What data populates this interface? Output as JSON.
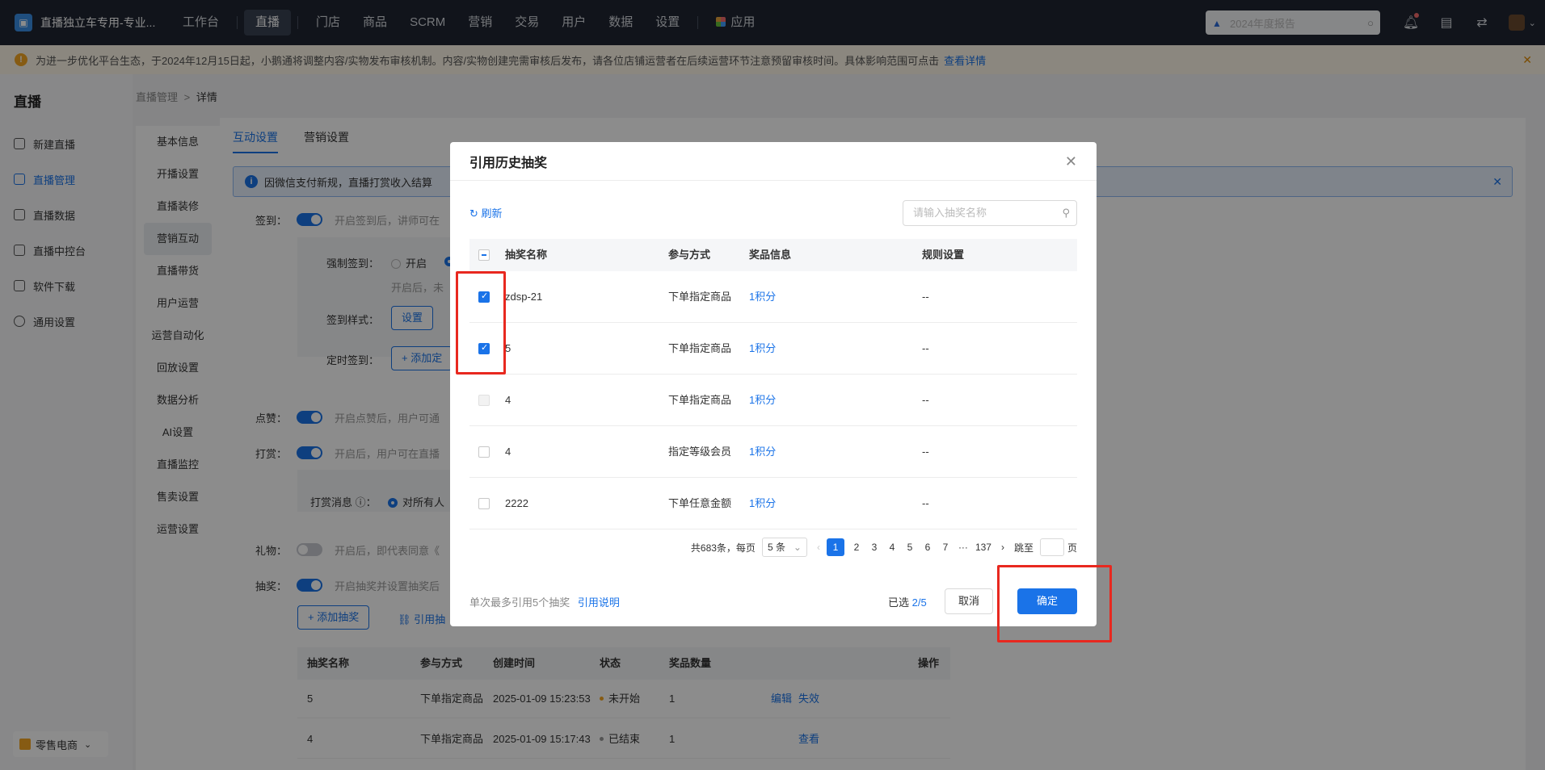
{
  "app": {
    "title": "直播独立车专用-专业..."
  },
  "topnav": {
    "items": [
      "工作台",
      "直播",
      "门店",
      "商品",
      "SCRM",
      "营销",
      "交易",
      "用户",
      "数据",
      "设置"
    ],
    "apps_label": "应用",
    "search_placeholder": "2024年度报告"
  },
  "notice": {
    "text": "为进一步优化平台生态，于2024年12月15日起，小鹅通将调整内容/实物发布审核机制。内容/实物创建完需审核后发布，请各位店铺运营者在后续运营环节注意预留审核时间。具体影响范围可点击",
    "link": "查看详情"
  },
  "sidebar": {
    "title": "直播",
    "items": [
      "新建直播",
      "直播管理",
      "直播数据",
      "直播中控台",
      "软件下载",
      "通用设置"
    ],
    "bottom": "零售电商"
  },
  "breadcrumb": {
    "parent": "直播管理",
    "sep": ">",
    "current": "详情"
  },
  "subnav": [
    "基本信息",
    "开播设置",
    "直播装修",
    "营销互动",
    "直播带货",
    "用户运营",
    "运营自动化",
    "回放设置",
    "数据分析",
    "AI设置",
    "直播监控",
    "售卖设置",
    "运营设置"
  ],
  "content": {
    "tabs": [
      "互动设置",
      "营销设置"
    ],
    "info": "因微信支付新规，直播打赏收入结算",
    "checkin_label": "签到：",
    "checkin_hint": "开启签到后，讲师可在",
    "force_label": "强制签到：",
    "force_on": "开启",
    "force_hint": "开启后，未",
    "style_label": "签到样式：",
    "style_btn": "设置",
    "timed_label": "定时签到：",
    "timed_btn": "+ 添加定",
    "like_label": "点赞：",
    "like_hint": "开启点赞后，用户可通",
    "reward_label": "打赏：",
    "reward_hint": "开启后，用户可在直播",
    "reward_msg_label": "打赏消息 ⓘ：",
    "reward_msg_opt": "对所有人",
    "gift_label": "礼物：",
    "gift_hint": "开启后，即代表同意《",
    "lottery_label": "抽奖：",
    "lottery_hint": "开启抽奖并设置抽奖后",
    "add_lottery": "+ 添加抽奖",
    "ref_lottery": "引用抽",
    "table_headers": [
      "抽奖名称",
      "参与方式",
      "创建时间",
      "状态",
      "奖品数量",
      "操作"
    ],
    "rows": [
      {
        "name": "5",
        "mode": "下单指定商品",
        "time": "2025-01-09 15:23:53",
        "status": "未开始",
        "count": "1",
        "ops": [
          "编辑",
          "失效"
        ]
      },
      {
        "name": "4",
        "mode": "下单指定商品",
        "time": "2025-01-09 15:17:43",
        "status": "已结束",
        "count": "1",
        "ops": [
          "查看"
        ]
      }
    ]
  },
  "modal": {
    "title": "引用历史抽奖",
    "refresh": "刷新",
    "search_placeholder": "请输入抽奖名称",
    "headers": [
      "抽奖名称",
      "参与方式",
      "奖品信息",
      "规则设置"
    ],
    "rows": [
      {
        "name": "zdsp-21",
        "mode": "下单指定商品",
        "prize": "1积分",
        "rule": "--",
        "checked": true
      },
      {
        "name": "5",
        "mode": "下单指定商品",
        "prize": "1积分",
        "rule": "--",
        "checked": true
      },
      {
        "name": "4",
        "mode": "下单指定商品",
        "prize": "1积分",
        "rule": "--",
        "checked": false,
        "disabled": true
      },
      {
        "name": "4",
        "mode": "指定等级会员",
        "prize": "1积分",
        "rule": "--",
        "checked": false
      },
      {
        "name": "2222",
        "mode": "下单任意金额",
        "prize": "1积分",
        "rule": "--",
        "checked": false
      }
    ],
    "pager": {
      "total": "共683条，每页",
      "per_page": "5 条",
      "pages": [
        "1",
        "2",
        "3",
        "4",
        "5",
        "6",
        "7",
        "···",
        "137"
      ],
      "current": 1,
      "jump_label": "跳至",
      "page_unit": "页"
    },
    "footer_hint": "单次最多引用5个抽奖",
    "footer_link": "引用说明",
    "selected_label": "已选",
    "selected_value": "2/5",
    "cancel": "取消",
    "confirm": "确定"
  },
  "colors": {
    "accent": "#1a73e8",
    "highlight": "#e8281f",
    "nav_bg": "#1f2532"
  }
}
